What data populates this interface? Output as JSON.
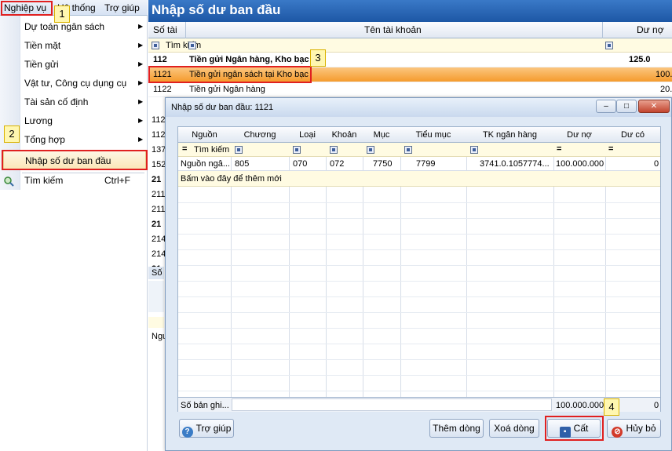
{
  "menubar": {
    "items": [
      "Nghiệp vụ",
      "Hệ thống",
      "Trợ giúp"
    ]
  },
  "menu": {
    "items": [
      {
        "label": "Dự toán ngân sách",
        "submenu": true
      },
      {
        "label": "Tiền mặt",
        "submenu": true
      },
      {
        "label": "Tiền gửi",
        "submenu": true
      },
      {
        "label": "Vật tư, Công cụ dụng cụ",
        "submenu": true
      },
      {
        "label": "Tài sản cố định",
        "submenu": true
      },
      {
        "label": "Lương",
        "submenu": true
      },
      {
        "label": "Tổng hợp",
        "submenu": true
      }
    ],
    "selected": "Nhập số dư ban đầu",
    "search": {
      "label": "Tìm kiếm",
      "shortcut": "Ctrl+F"
    }
  },
  "callouts": [
    "1",
    "2",
    "3",
    "4"
  ],
  "main": {
    "title": "Nhập số dư ban đầu",
    "columns": [
      "Số tài",
      "Tên tài khoản",
      "Dư nợ"
    ],
    "filter_label": "Tìm kiếm",
    "rows": [
      {
        "code": "112",
        "name": "Tiền gửi Ngân hàng, Kho bạc",
        "debit": "125.0",
        "bold": true
      },
      {
        "code": "1121",
        "name": "Tiền gửi ngân sách tại Kho bạc",
        "debit": "100.",
        "selected": true
      },
      {
        "code": "1122",
        "name": "Tiền gửi Ngân hàng",
        "debit": "20."
      }
    ],
    "partial_codes": [
      "112",
      "112",
      "137",
      "152",
      "21",
      "211",
      "211",
      "21",
      "214",
      "214",
      "21"
    ],
    "partial_bottom": [
      "Số",
      "Ngu"
    ]
  },
  "dialog": {
    "title": "Nhập số dư ban đầu: 1121",
    "window_buttons": [
      "–",
      "□",
      "✕"
    ],
    "columns": [
      "Nguồn",
      "Chương",
      "Loại",
      "Khoản",
      "Mục",
      "Tiểu mục",
      "TK ngân hàng",
      "Dư nợ",
      "Dư có"
    ],
    "filter_label": "Tìm kiếm",
    "row": [
      "Nguồn ngâ...",
      "805",
      "070",
      "072",
      "7750",
      "7799",
      "3741.0.1057774...",
      "100.000.000",
      "0"
    ],
    "add_new": "Bấm vào đây để thêm mới",
    "footer": {
      "label": "Số bản ghi...",
      "debit_total": "100.000.000",
      "credit_total": "0"
    },
    "buttons": {
      "help": "Trợ giúp",
      "add_row": "Thêm dòng",
      "delete_row": "Xoá dòng",
      "save": "Cất",
      "cancel": "Hủy bỏ"
    }
  }
}
